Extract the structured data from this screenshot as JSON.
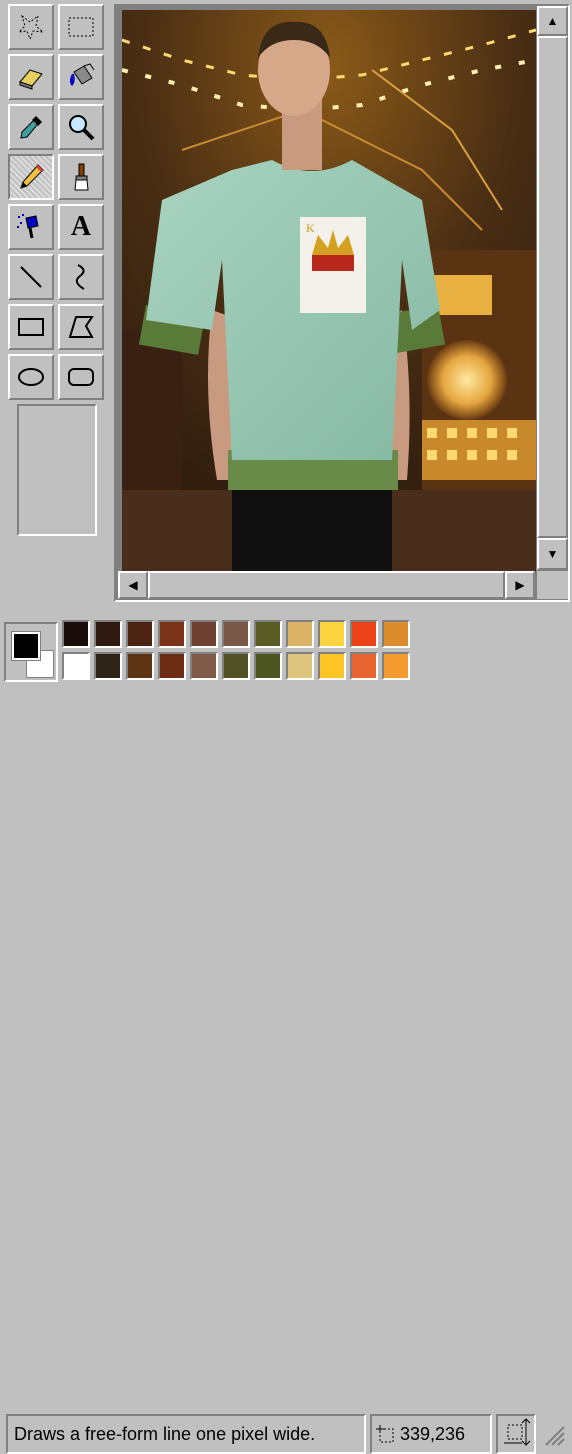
{
  "tools": [
    {
      "name": "free-form-select-tool",
      "icon": "free-form-select-icon",
      "pressed": false
    },
    {
      "name": "select-tool",
      "icon": "rect-select-icon",
      "pressed": false
    },
    {
      "name": "eraser-tool",
      "icon": "eraser-icon",
      "pressed": false
    },
    {
      "name": "fill-tool",
      "icon": "paint-bucket-icon",
      "pressed": false
    },
    {
      "name": "pick-color-tool",
      "icon": "eyedropper-icon",
      "pressed": false
    },
    {
      "name": "magnifier-tool",
      "icon": "magnifier-icon",
      "pressed": false
    },
    {
      "name": "pencil-tool",
      "icon": "pencil-icon",
      "pressed": true
    },
    {
      "name": "brush-tool",
      "icon": "brush-icon",
      "pressed": false
    },
    {
      "name": "airbrush-tool",
      "icon": "airbrush-icon",
      "pressed": false
    },
    {
      "name": "text-tool",
      "icon": "text-icon",
      "pressed": false,
      "glyph": "A"
    },
    {
      "name": "line-tool",
      "icon": "line-icon",
      "pressed": false
    },
    {
      "name": "curve-tool",
      "icon": "curve-icon",
      "pressed": false
    },
    {
      "name": "rectangle-tool",
      "icon": "rectangle-icon",
      "pressed": false
    },
    {
      "name": "polygon-tool",
      "icon": "polygon-icon",
      "pressed": false
    },
    {
      "name": "ellipse-tool",
      "icon": "ellipse-icon",
      "pressed": false
    },
    {
      "name": "rounded-rectangle-tool",
      "icon": "rounded-rectangle-icon",
      "pressed": false
    }
  ],
  "canvas": {
    "image_icon": "photo-icon",
    "card_mark": "K"
  },
  "colors": {
    "foreground": "#000000",
    "background": "#ffffff",
    "palette_row1": [
      "#1a0c08",
      "#2e1a10",
      "#4a2410",
      "#7a3218",
      "#6e4030",
      "#7a5848",
      "#5a5a24",
      "#dcb468",
      "#fcd440",
      "#ec4418",
      "#dc8c2c"
    ],
    "palette_row2": [
      "#ffffff",
      "#2e2418",
      "#5c3414",
      "#6c2c14",
      "#805c48",
      "#505024",
      "#4c5420",
      "#dcc47c",
      "#fcc424",
      "#e86430",
      "#f49c30"
    ]
  },
  "status": {
    "help_text": "Draws a free-form line one pixel wide.",
    "coordinates": "339,236",
    "position_icon": "cursor-position-icon",
    "size_icon": "selection-size-icon"
  }
}
